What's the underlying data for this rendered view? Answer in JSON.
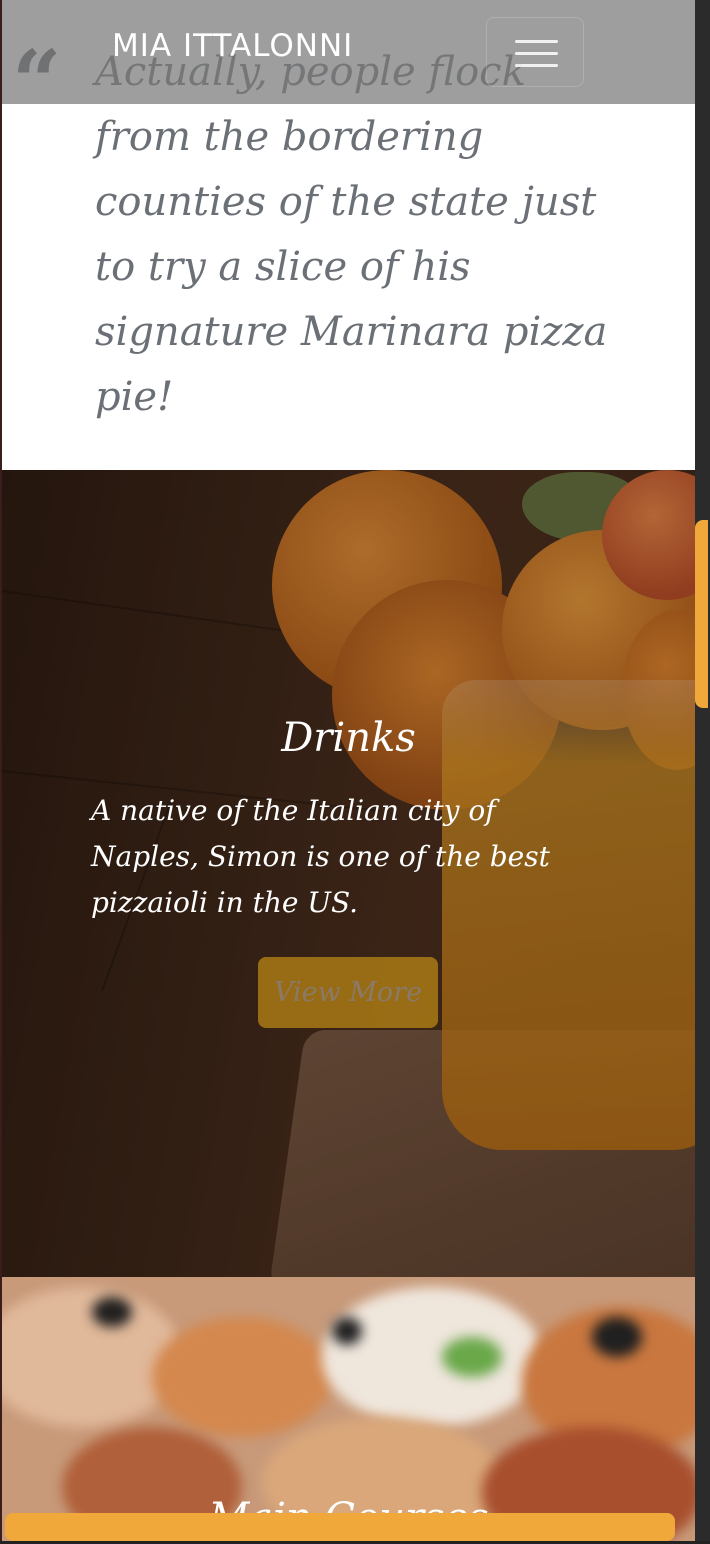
{
  "navbar": {
    "brand": "MIA ITTALONNI",
    "toggle_icon": "hamburger-menu-icon"
  },
  "quote": {
    "icon": "quote-icon",
    "text": "Actually, people flock from the bordering counties of the state just to try a slice of his signature Marinara pizza pie!"
  },
  "drinks": {
    "title": "Drinks",
    "description": "A native of the Italian city of Naples, Simon is one of the best pizzaioli in the US.",
    "button_label": "View More"
  },
  "main_courses": {
    "title": "Main Courses"
  },
  "colors": {
    "accent": "#f1a83a",
    "quote_text": "#6b7077",
    "navbar_bg": "#787878"
  }
}
